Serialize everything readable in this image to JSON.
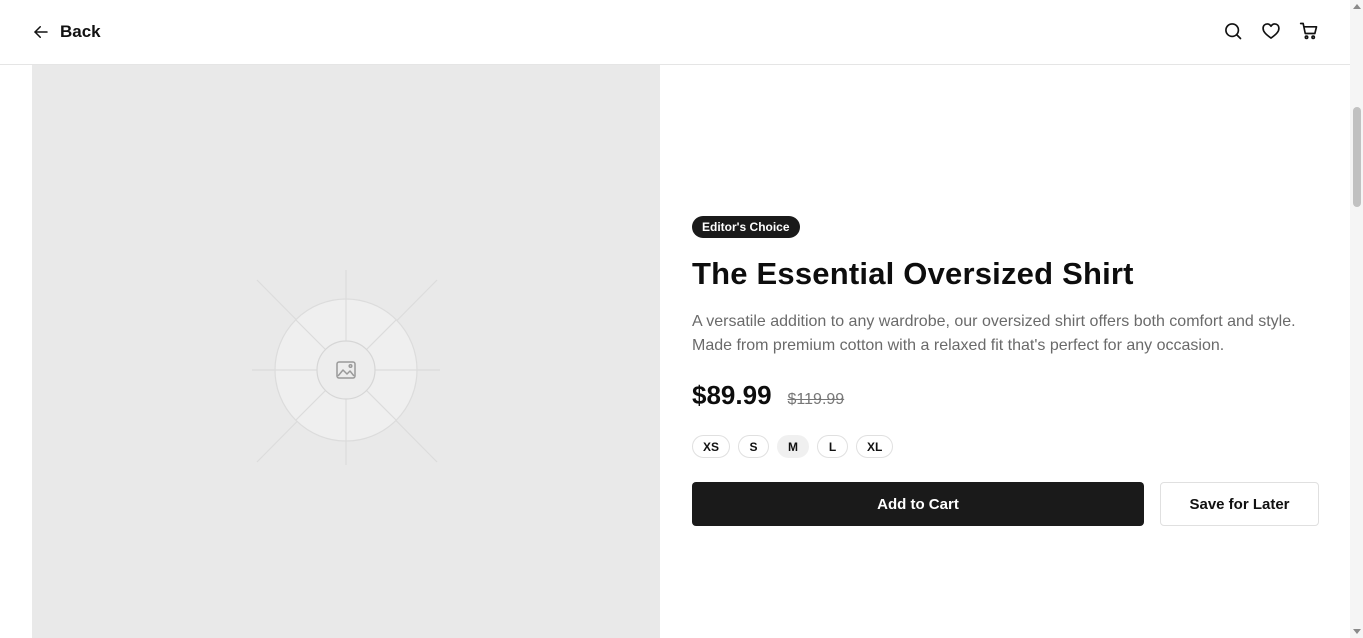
{
  "header": {
    "back_label": "Back",
    "icons": [
      "search-icon",
      "heart-icon",
      "cart-icon"
    ]
  },
  "product": {
    "badge": "Editor's Choice",
    "title": "The Essential Oversized Shirt",
    "description": "A versatile addition to any wardrobe, our oversized shirt offers both comfort and style. Made from premium cotton with a relaxed fit that's perfect for any occasion.",
    "price": "$89.99",
    "original_price": "$119.99",
    "sizes": [
      "XS",
      "S",
      "M",
      "L",
      "XL"
    ],
    "selected_size": "M",
    "add_to_cart_label": "Add to Cart",
    "save_label": "Save for Later"
  },
  "colors": {
    "primary": "#1a1a1a",
    "image_bg": "#e9e9e9",
    "muted_text": "#6a6a6a"
  }
}
